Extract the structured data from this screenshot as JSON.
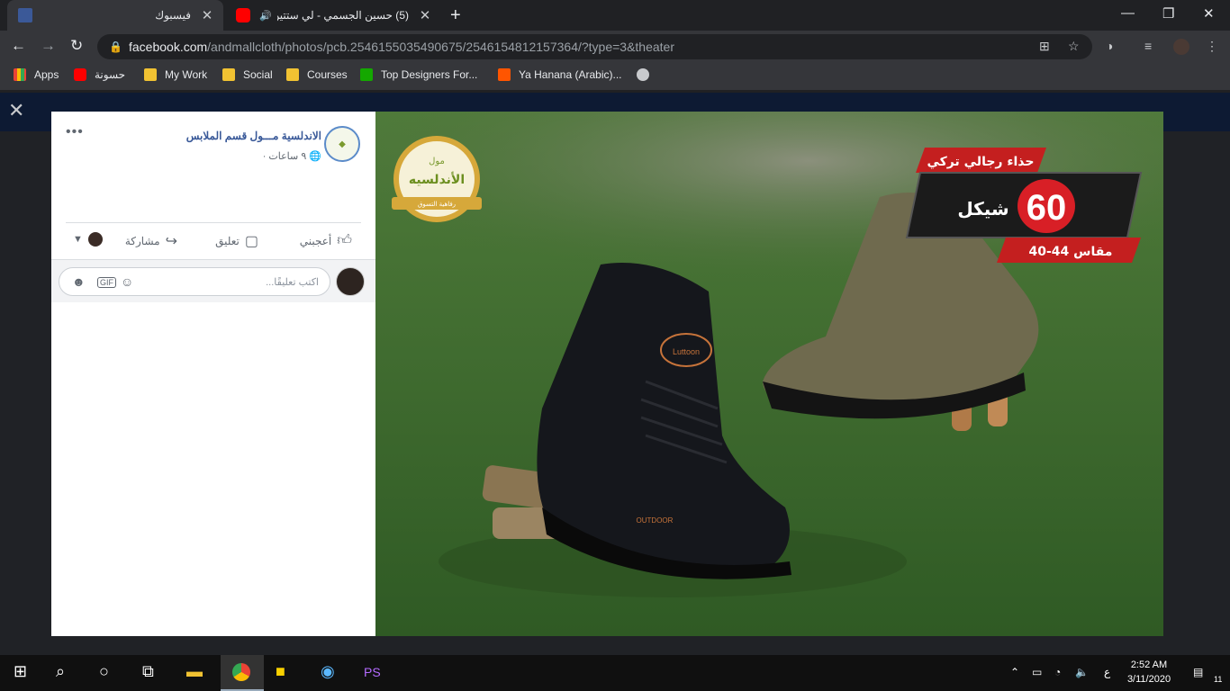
{
  "browser": {
    "tabs": [
      {
        "title": "فيسبوك",
        "icon": "facebook-icon",
        "active": true
      },
      {
        "title": "(5) حسين الجسمي - لي ستتين",
        "icon": "youtube-icon",
        "active": false
      }
    ],
    "address": {
      "host": "facebook.com",
      "path": "/andmallcloth/photos/pcb.2546155035490675/2546154812157364/?type=3&theater"
    },
    "bookmarks": [
      {
        "label": "Apps",
        "icon": "apps-grid-icon",
        "color": "#f4b400"
      },
      {
        "label": "حسونة",
        "icon": "youtube-icon",
        "color": "#ff0000"
      },
      {
        "label": "My Work",
        "icon": "folder-icon",
        "color": "#f1c232"
      },
      {
        "label": "Social",
        "icon": "folder-icon",
        "color": "#f1c232"
      },
      {
        "label": "Courses",
        "icon": "folder-icon",
        "color": "#f1c232"
      },
      {
        "label": "Top Designers For...",
        "icon": "upwork-icon",
        "color": "#14a800"
      },
      {
        "label": "Ya Hanana (Arabic)...",
        "icon": "soundcloud-icon",
        "color": "#ff5500"
      },
      {
        "label": "",
        "icon": "globe-icon",
        "color": "#c8cacd"
      }
    ]
  },
  "post": {
    "page_name": "الاندلسية مـــول قسم الملابس",
    "time": "٩ ساعات ·",
    "actions": {
      "like": "أعجبني",
      "comment": "تعليق",
      "share": "مشاركة"
    },
    "comment_placeholder": "اكتب تعليقًا..."
  },
  "photo": {
    "logo_main": "الأندلسيه",
    "logo_sub": "رفاهية التسوق",
    "logo_top": "مول",
    "banner_title": "حذاء رجالي تركي",
    "price": "60",
    "currency": "شيكل",
    "sizes": "مقاس 44-40",
    "shoe_brand": "Luttoon",
    "shoe_sole": "OUTDOOR"
  },
  "taskbar": {
    "time": "2:52 AM",
    "date": "3/11/2020",
    "lang": "ع",
    "notifications": "11"
  }
}
